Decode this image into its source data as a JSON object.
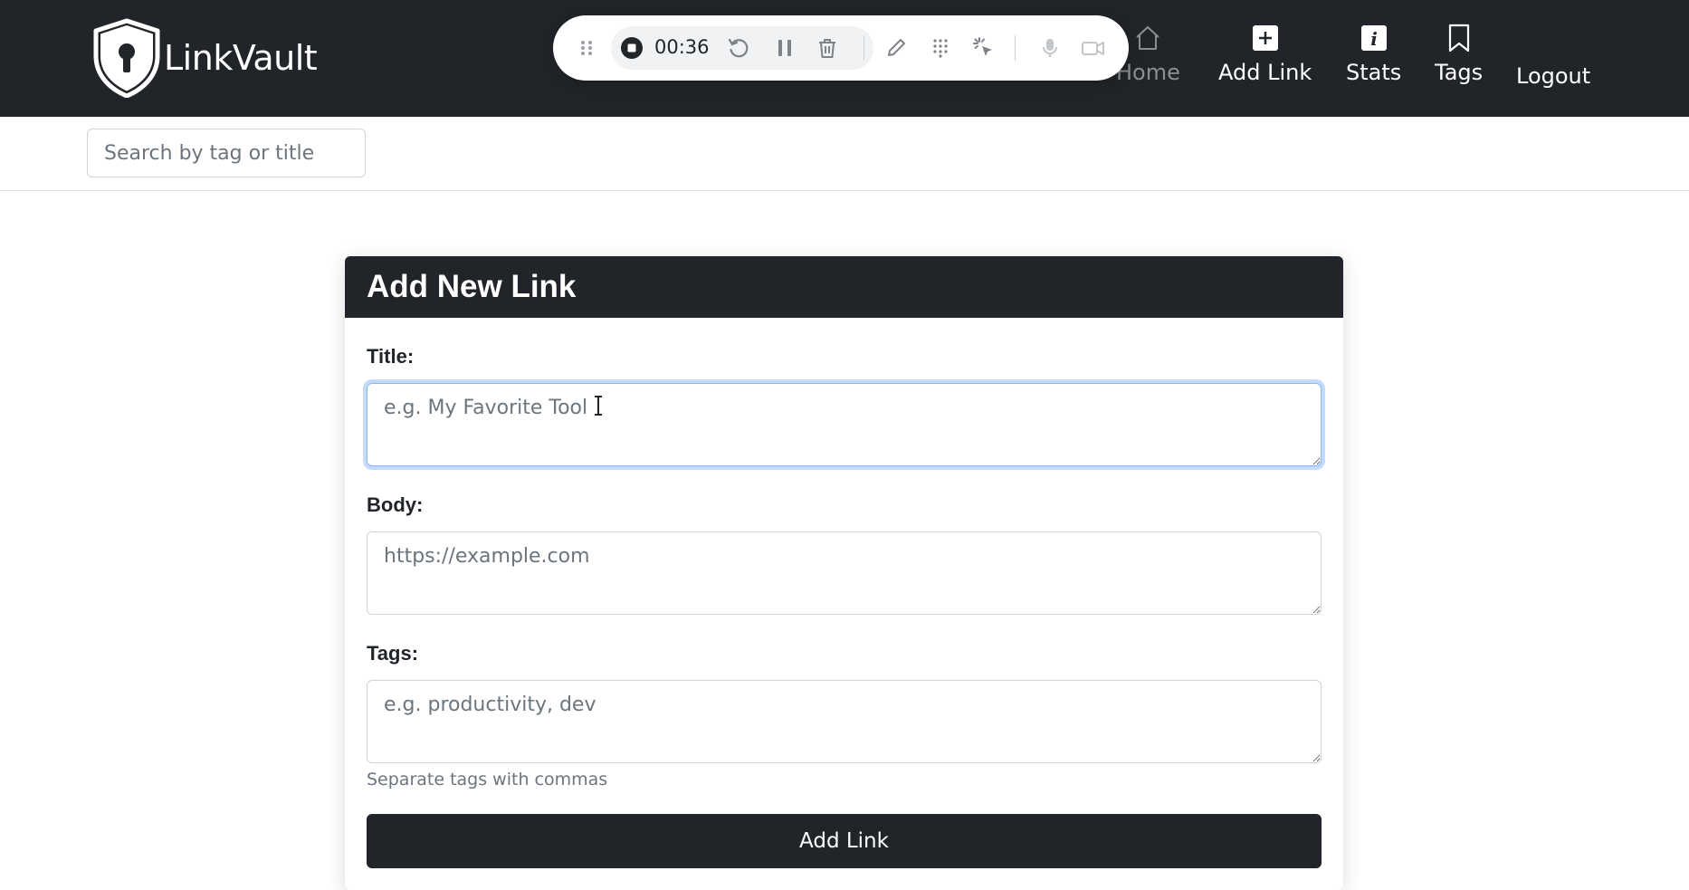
{
  "brand": {
    "name": "LinkVault"
  },
  "nav": {
    "home": "Home",
    "add_link": "Add Link",
    "stats": "Stats",
    "tags": "Tags",
    "logout": "Logout"
  },
  "recorder": {
    "elapsed": "00:36",
    "icons": [
      "drag-handle-icon",
      "stop-icon",
      "restart-icon",
      "pause-icon",
      "trash-icon",
      "pen-icon",
      "grid-icon",
      "click-highlight-icon",
      "microphone-icon",
      "camera-icon"
    ]
  },
  "search": {
    "placeholder": "Search by tag or title"
  },
  "form": {
    "heading": "Add New Link",
    "title_label": "Title:",
    "title_placeholder": "e.g. My Favorite Tool",
    "body_label": "Body:",
    "body_placeholder": "https://example.com",
    "tags_label": "Tags:",
    "tags_placeholder": "e.g. productivity, dev",
    "tags_help": "Separate tags with commas",
    "submit_label": "Add Link"
  },
  "colors": {
    "navbar": "#212529",
    "focus_ring": "#86b7fe",
    "muted": "#6c757d"
  }
}
